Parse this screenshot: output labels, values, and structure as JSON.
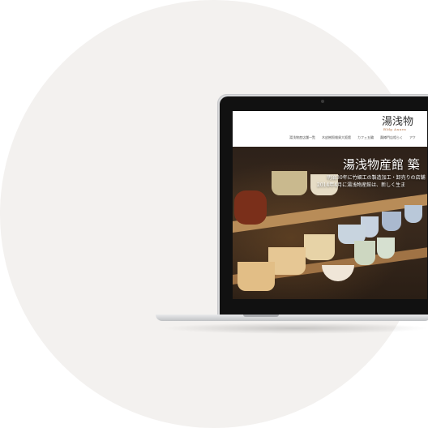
{
  "site": {
    "logo_title": "湯浅物",
    "logo_sub": "Bldg Annex",
    "nav": [
      "湯浅物産店舗一覧",
      "木皮樹照雑貨大阪館",
      "カフェ五輪",
      "醤樽門店相らく",
      "アク"
    ],
    "hero_title": "湯浅物産館 築",
    "hero_line1": "明治30年に竹細工の製造加工・卸売りの店舗",
    "hero_line2": "2014年4月に湯浅物産館は、新しく生ま"
  }
}
